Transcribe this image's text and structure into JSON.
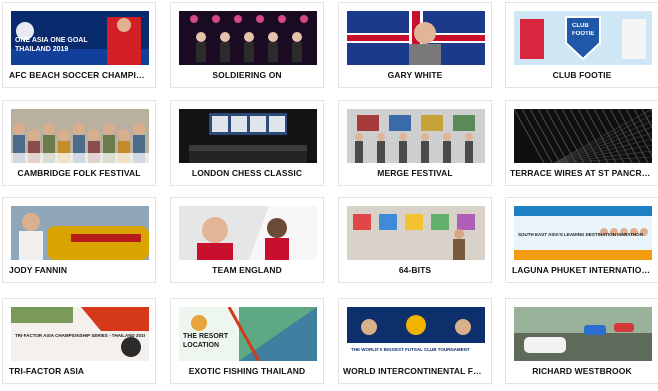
{
  "cards": [
    {
      "title": "AFC BEACH SOCCER CHAMPIONSHIPS",
      "thumb_text": [
        "ONE ASIA ONE GOAL",
        "THAILAND 2019"
      ],
      "colors": [
        "#0a2a6e",
        "#d31f26"
      ],
      "icon": "soccer-banner-image"
    },
    {
      "title": "SOLDIERING ON",
      "thumb_text": [],
      "colors": [
        "#1a0b22",
        "#c2185b"
      ],
      "icon": "concert-stage-image"
    },
    {
      "title": "GARY WHITE",
      "thumb_text": [],
      "colors": [
        "#1b3a8c",
        "#c8102e"
      ],
      "icon": "portrait-flag-image"
    },
    {
      "title": "CLUB FOOTIE",
      "thumb_text": [
        "CLUB",
        "FOOTIE"
      ],
      "colors": [
        "#cfe6f5",
        "#1f58a8"
      ],
      "icon": "football-badge-image"
    },
    {
      "title": "CAMBRIDGE FOLK FESTIVAL",
      "thumb_text": [],
      "colors": [
        "#6d7b4a",
        "#b9b0a0"
      ],
      "icon": "festival-crowd-image"
    },
    {
      "title": "LONDON CHESS CLASSIC",
      "thumb_text": [],
      "colors": [
        "#141414",
        "#2e4a7a"
      ],
      "icon": "chess-stage-image"
    },
    {
      "title": "MERGE FESTIVAL",
      "thumb_text": [],
      "colors": [
        "#cfcfcf",
        "#4a4a4a"
      ],
      "icon": "gallery-visitors-image"
    },
    {
      "title": "TERRACE WIRES AT ST PANCRAS INTERNATIONAL",
      "thumb_text": [],
      "colors": [
        "#0f0f0f",
        "#3a3a3a"
      ],
      "icon": "wire-sculpture-image"
    },
    {
      "title": "JODY FANNIN",
      "thumb_text": [],
      "colors": [
        "#d9a400",
        "#b71c1c"
      ],
      "icon": "racing-driver-image"
    },
    {
      "title": "TEAM ENGLAND",
      "thumb_text": [],
      "colors": [
        "#e6e6e6",
        "#c8102e"
      ],
      "icon": "athletes-image"
    },
    {
      "title": "64-BITS",
      "thumb_text": [],
      "colors": [
        "#d8d2c8",
        "#7a5a3a"
      ],
      "icon": "art-exhibit-image"
    },
    {
      "title": "LAGUNA PHUKET INTERNATIONAL MARATHON",
      "thumb_text": [
        "SOUTH EAST ASIA'S LEADING DESTINATION MARATHON"
      ],
      "colors": [
        "#e9f4fb",
        "#1e7fc4"
      ],
      "icon": "marathon-banner-image"
    },
    {
      "title": "TRI-FACTOR ASIA",
      "thumb_text": [
        "TRI-FACTOR ASIA CHAMPIONSHIP SERIES - THAILAND 2019"
      ],
      "colors": [
        "#f4f1ec",
        "#d6381a"
      ],
      "icon": "triathlon-banner-image"
    },
    {
      "title": "EXOTIC FISHING THAILAND",
      "thumb_text": [
        "THE RESORT",
        "LOCATION"
      ],
      "colors": [
        "#eef6f0",
        "#d6381a"
      ],
      "icon": "fishing-banner-image"
    },
    {
      "title": "WORLD INTERCONTINENTAL FUTSAL CLUB CUP",
      "thumb_text": [
        "THE WORLD'S BIGGEST FUTSAL CLUB TOURNAMENT"
      ],
      "colors": [
        "#0d2f6b",
        "#f0b400"
      ],
      "icon": "futsal-banner-image"
    },
    {
      "title": "RICHARD WESTBROOK",
      "thumb_text": [],
      "colors": [
        "#5f6b5a",
        "#e4e4e4"
      ],
      "icon": "race-cars-image"
    }
  ]
}
